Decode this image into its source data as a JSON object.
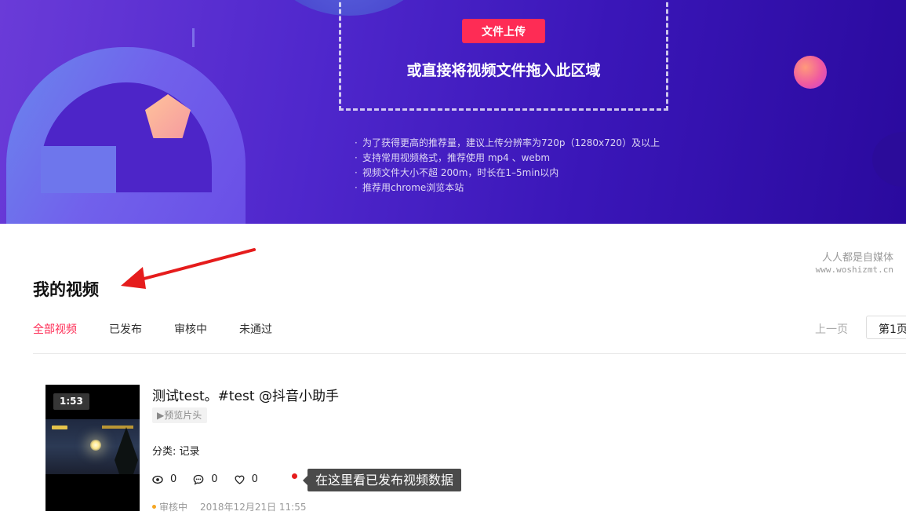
{
  "upload": {
    "button_label": "文件上传",
    "drop_hint": "或直接将视频文件拖入此区域",
    "tips": [
      "为了获得更高的推荐量，建议上传分辨率为720p（1280x720）及以上",
      "支持常用视频格式，推荐使用 mp4 、webm",
      "视频文件大小不超 200m，时长在1–5min以内",
      "推荐用chrome浏览本站"
    ],
    "tip_bullet": "·"
  },
  "watermark": {
    "line1": "人人都是自媒体",
    "line2": "www.woshizmt.cn"
  },
  "page_title": "我的视频",
  "tabs": [
    {
      "label": "全部视频",
      "active": true
    },
    {
      "label": "已发布",
      "active": false
    },
    {
      "label": "审核中",
      "active": false
    },
    {
      "label": "未通过",
      "active": false
    }
  ],
  "pagination": {
    "prev_label": "上一页",
    "current_page": "第1页"
  },
  "video": {
    "duration": "1:53",
    "title": "测试test。#test @抖音小助手",
    "preview_label": "▶预览片头",
    "category": "分类: 记录",
    "stats": {
      "views": "0",
      "comments": "0",
      "likes": "0"
    },
    "status": "审核中",
    "datetime": "2018年12月21日 11:55"
  },
  "annotation": {
    "callout_text": "在这里看已发布视频数据",
    "arrow_color": "#e51c1c"
  },
  "colors": {
    "accent": "#fe2c55",
    "status_pending": "#f5a623",
    "banner_start": "#6a3bd8",
    "banner_end": "#2a0a9e"
  }
}
